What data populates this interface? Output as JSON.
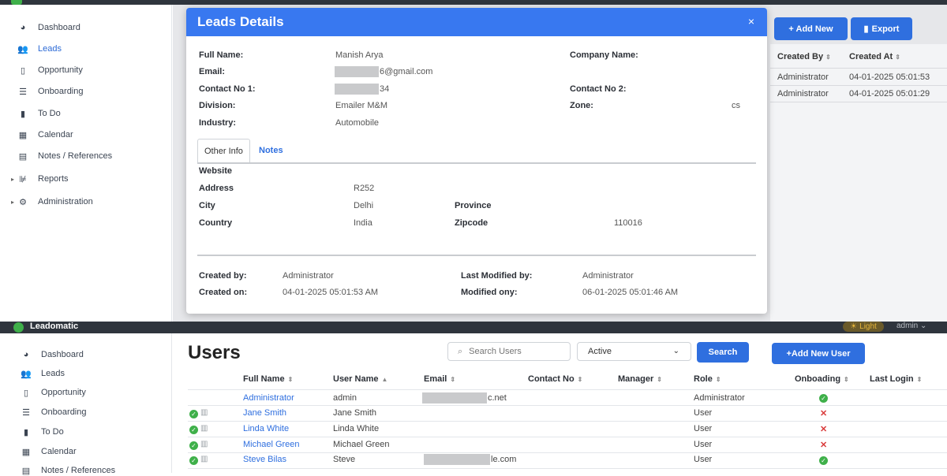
{
  "top": {
    "sidebar": [
      {
        "label": "Dashboard",
        "icon": "dashboard-icon"
      },
      {
        "label": "Leads",
        "icon": "users-icon",
        "active": true
      },
      {
        "label": "Opportunity",
        "icon": "clipboard-icon"
      },
      {
        "label": "Onboarding",
        "icon": "list-icon"
      },
      {
        "label": "To Do",
        "icon": "file-icon"
      },
      {
        "label": "Calendar",
        "icon": "calendar-icon"
      },
      {
        "label": "Notes / References",
        "icon": "book-icon"
      },
      {
        "label": "Reports",
        "icon": "chart-icon",
        "expandable": true
      },
      {
        "label": "Administration",
        "icon": "gear-icon",
        "expandable": true
      }
    ],
    "background": {
      "add_new": "+ Add New",
      "export": "Export",
      "headers": [
        "Created By",
        "Created At"
      ],
      "rows": [
        [
          "Administrator",
          "04-01-2025 05:01:53"
        ],
        [
          "Administrator",
          "04-01-2025 05:01:29"
        ]
      ]
    },
    "modal": {
      "title": "Leads Details",
      "close": "×",
      "full_name_label": "Full Name:",
      "full_name": "Manish Arya",
      "company_label": "Company Name:",
      "email_label": "Email:",
      "email_visible": "6@gmail.com",
      "contact1_label": "Contact No 1:",
      "contact1_visible": "34",
      "contact2_label": "Contact No 2:",
      "division_label": "Division:",
      "division": "Emailer M&M",
      "zone_label": "Zone:",
      "zone": "cs",
      "industry_label": "Industry:",
      "industry": "Automobile",
      "tabs": [
        "Other Info",
        "Notes"
      ],
      "website_label": "Website",
      "address_label": "Address",
      "address": "R252",
      "city_label": "City",
      "city": "Delhi",
      "province_label": "Province",
      "country_label": "Country",
      "country": "India",
      "zipcode_label": "Zipcode",
      "zipcode": "110016",
      "created_by_label": "Created by:",
      "created_by": "Administrator",
      "created_on_label": "Created on:",
      "created_on": "04-01-2025 05:01:53 AM",
      "modified_by_label": "Last Modified by:",
      "modified_by": "Administrator",
      "modified_on_label": "Modified ony:",
      "modified_on": "06-01-2025 05:01:46 AM"
    }
  },
  "bottom": {
    "brand": "Leadomatic",
    "theme_toggle": "Light",
    "user_menu": "admin",
    "sidebar": [
      {
        "label": "Dashboard",
        "icon": "dashboard-icon"
      },
      {
        "label": "Leads",
        "icon": "users-icon"
      },
      {
        "label": "Opportunity",
        "icon": "clipboard-icon"
      },
      {
        "label": "Onboarding",
        "icon": "list-icon"
      },
      {
        "label": "To Do",
        "icon": "file-icon"
      },
      {
        "label": "Calendar",
        "icon": "calendar-icon"
      },
      {
        "label": "Notes / References",
        "icon": "book-icon"
      }
    ],
    "title": "Users",
    "search_placeholder": "Search Users",
    "status_filter": "Active",
    "search_button": "Search",
    "add_user_button": "+Add New User",
    "columns": [
      "Full Name",
      "User Name",
      "Email",
      "Contact No",
      "Manager",
      "Role",
      "Onboading",
      "Last Login"
    ],
    "rows": [
      {
        "full_name": "Administrator",
        "user_name": "admin",
        "email_visible": "c.net",
        "role": "Administrator",
        "onboarding": true,
        "actions": false
      },
      {
        "full_name": "Jane Smith",
        "user_name": "Jane Smith",
        "email_visible": "",
        "role": "User",
        "onboarding": false,
        "actions": true
      },
      {
        "full_name": "Linda White",
        "user_name": "Linda White",
        "email_visible": "",
        "role": "User",
        "onboarding": false,
        "actions": true
      },
      {
        "full_name": "Michael Green",
        "user_name": "Michael Green",
        "email_visible": "",
        "role": "User",
        "onboarding": false,
        "actions": true
      },
      {
        "full_name": "Steve Bilas",
        "user_name": "Steve",
        "email_visible": "le.com",
        "role": "User",
        "onboarding": true,
        "actions": true
      }
    ],
    "colors": {
      "accent": "#2f6fdf",
      "success": "#3fb04a",
      "danger": "#d93a3a",
      "navbar": "#2f353d"
    }
  }
}
